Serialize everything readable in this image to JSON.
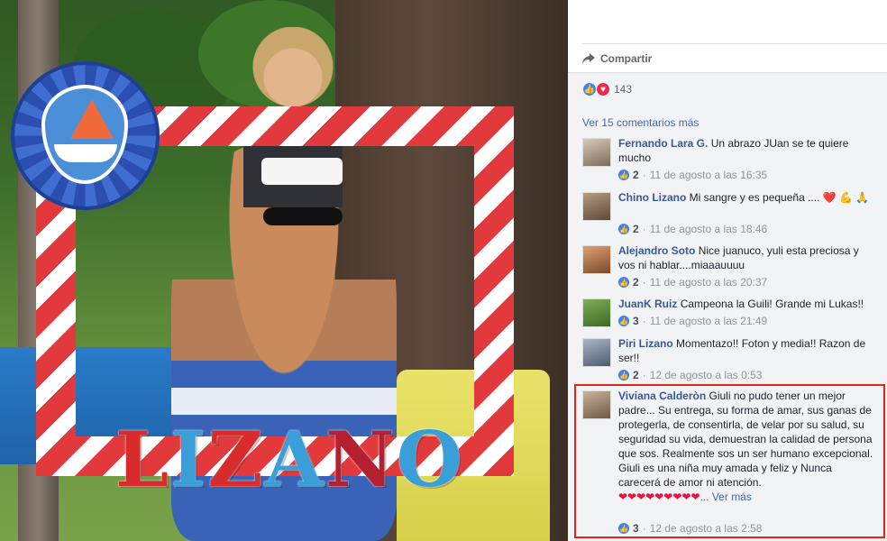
{
  "photo": {
    "letters": [
      "L",
      "I",
      "Z",
      "A",
      "N",
      "O"
    ],
    "letter_colors": [
      "#d82b2b",
      "#3a9fd8",
      "#d82b2b",
      "#3a9fd8",
      "#b51f32",
      "#3a9fd8"
    ]
  },
  "panel": {
    "share_label": "Compartir",
    "reaction_count": "143",
    "more_comments": "Ver 15 comentarios más",
    "see_more": "Ver más",
    "comments": [
      {
        "name": "Fernando Lara G.",
        "text": "Un abrazo JUan se te quiere mucho",
        "likes": "2",
        "time": "11 de agosto a las 16:35"
      },
      {
        "name": "Chino Lizano",
        "text": "Mi sangre y es pequeña ....",
        "emoji": "❤️ 💪 🙏",
        "likes": "2",
        "time": "11 de agosto a las 18:46"
      },
      {
        "name": "Alejandro Soto",
        "text": "Nice juanuco, yuli esta preciosa y vos ni hablar....miaaauuuu",
        "likes": "2",
        "time": "11 de agosto a las 20:37"
      },
      {
        "name": "JuanK Ruiz",
        "text": "Campeona la Guili! Grande mi Lukas!!",
        "likes": "3",
        "time": "11 de agosto a las 21:49"
      },
      {
        "name": "Piri Lizano",
        "text": "Momentazo!! Foton y media!! Razon de ser!!",
        "likes": "2",
        "time": "12 de agosto a las 0:53"
      },
      {
        "name": "Viviana Calderòn",
        "text": "Giuli no pudo tener un mejor padre... Su entrega, su forma de amar, sus ganas de protegerla, de consentirla, de velar por su salud, su seguridad su vida, demuestran la calidad de persona que sos. Realmente sos un ser humano excepcional.",
        "text2": "Giuli es una niña muy amada y feliz y Nunca carecerá de amor ni atención.",
        "hearts": "❤❤❤❤❤❤❤❤❤...",
        "likes": "3",
        "time": "12 de agosto a las 2:58"
      }
    ]
  },
  "colors": {
    "link": "#385898",
    "highlight": "#e0241b",
    "like_blue": "#4080ff",
    "love_red": "#f0284a"
  }
}
